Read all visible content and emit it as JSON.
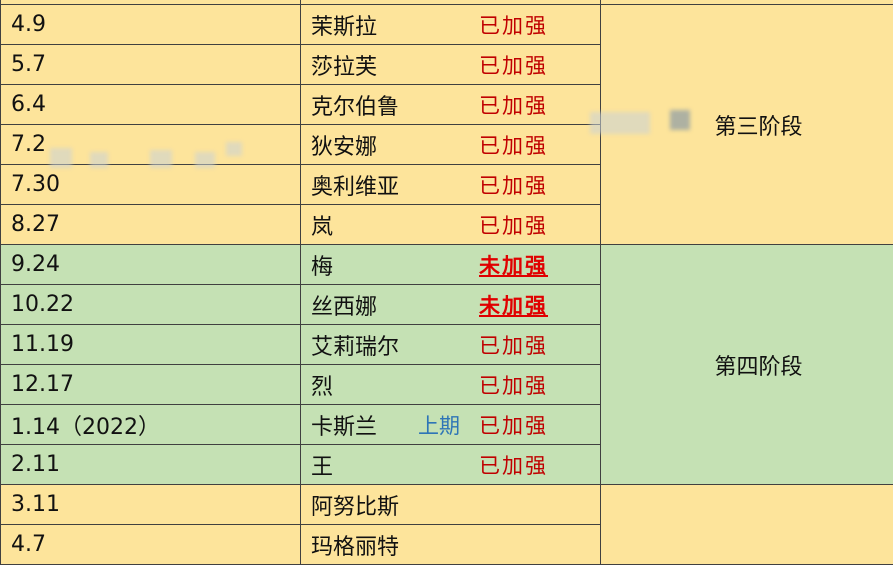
{
  "rows": [
    {
      "date": "4.9",
      "name": "茉斯拉",
      "status": "已加强",
      "period": ""
    },
    {
      "date": "5.7",
      "name": "莎拉芙",
      "status": "已加强",
      "period": ""
    },
    {
      "date": "6.4",
      "name": "克尔伯鲁",
      "status": "已加强",
      "period": ""
    },
    {
      "date": "7.2",
      "name": "狄安娜",
      "status": "已加强",
      "period": ""
    },
    {
      "date": "7.30",
      "name": "奥利维亚",
      "status": "已加强",
      "period": ""
    },
    {
      "date": "8.27",
      "name": "岚",
      "status": "已加强",
      "period": ""
    },
    {
      "date": "9.24",
      "name": "梅",
      "status": "未加强",
      "period": ""
    },
    {
      "date": "10.22",
      "name": "丝西娜",
      "status": "未加强",
      "period": ""
    },
    {
      "date": "11.19",
      "name": "艾莉瑞尔",
      "status": "已加强",
      "period": ""
    },
    {
      "date": "12.17",
      "name": "烈",
      "status": "已加强",
      "period": ""
    },
    {
      "date": "1.14（2022）",
      "name": "卡斯兰",
      "status": "已加强",
      "period": "上期"
    },
    {
      "date": "2.11",
      "name": "王",
      "status": "已加强",
      "period": ""
    },
    {
      "date": "3.11",
      "name": "阿努比斯",
      "status": "",
      "period": ""
    },
    {
      "date": "4.7",
      "name": "玛格丽特",
      "status": "",
      "period": ""
    }
  ],
  "stages": {
    "third": "第三阶段",
    "fourth": "第四阶段"
  },
  "colors": {
    "yellow": "#fde49b",
    "green": "#c5e1b4",
    "status_red": "#c00000",
    "period_blue": "#2e75b6"
  }
}
